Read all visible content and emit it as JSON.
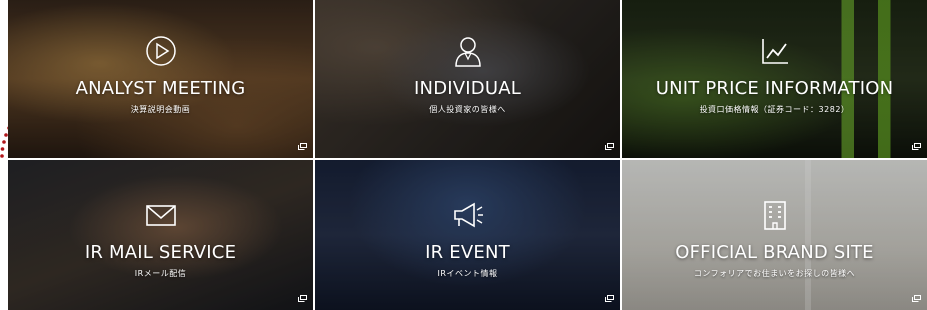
{
  "tiles": [
    {
      "title": "ANALYST MEETING",
      "sub": "決算説明会動画"
    },
    {
      "title": "INDIVIDUAL",
      "sub": "個人投資家の皆様へ"
    },
    {
      "title": "UNIT PRICE INFORMATION",
      "sub": "投資口価格情報（証券コード：3282）"
    },
    {
      "title": "IR MAIL SERVICE",
      "sub": "IRメール配信"
    },
    {
      "title": "IR EVENT",
      "sub": "IRイベント情報"
    },
    {
      "title": "OFFICIAL BRAND SITE",
      "sub": "コンフォリアでお住まいをお探しの皆様へ"
    }
  ],
  "colors": {
    "selection": "#b0161b"
  }
}
